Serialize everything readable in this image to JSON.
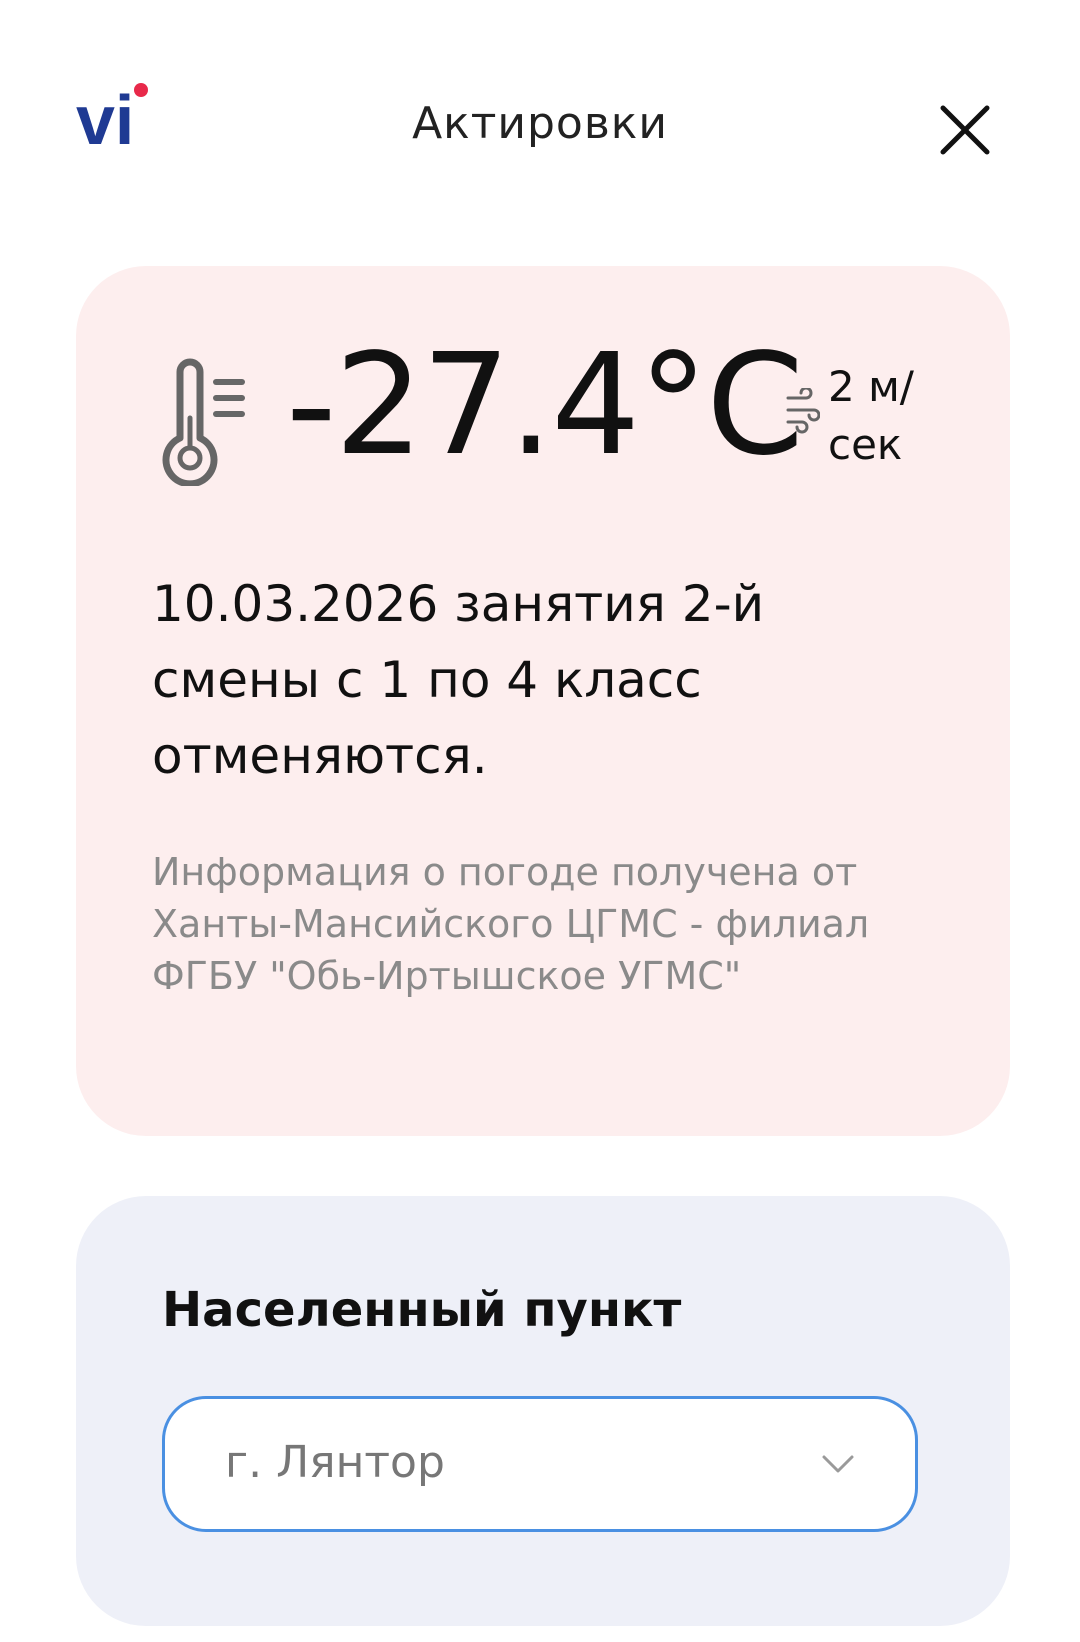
{
  "header": {
    "logo_text": "vi",
    "title": "Актировки",
    "close_icon": "close-icon"
  },
  "weather": {
    "temperature": "-27.4°C",
    "wind_speed": "2 м/сек",
    "message": "10.03.2026 занятия 2-й смены с 1 по 4 класс отменяются.",
    "source": "Информация о погоде получена от Ханты-Мансийского ЦГМС - филиал ФГБУ \"Обь-Иртышское УГМС\"",
    "background_color": "#fdeeee",
    "icons": [
      "thermometer-icon",
      "wind-icon"
    ]
  },
  "location": {
    "label": "Населенный пункт",
    "selected": "г. Лянтор",
    "background_color": "#eef0f8",
    "border_color": "#4a90e2",
    "icon": "chevron-down-icon"
  },
  "colors": {
    "logo_blue": "#1f3a93",
    "logo_dot": "#e8294a"
  }
}
